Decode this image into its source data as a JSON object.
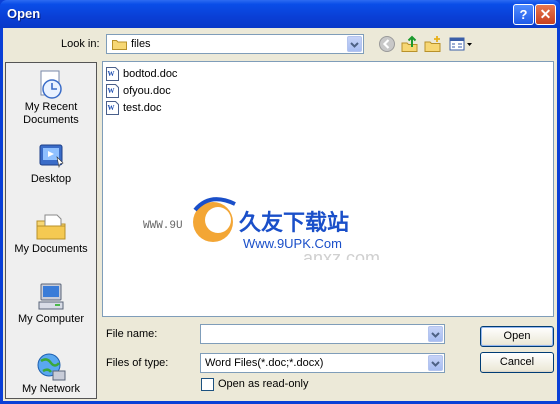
{
  "window": {
    "title": "Open",
    "help_glyph": "?",
    "close_glyph": "✕"
  },
  "lookin": {
    "label": "Look in:",
    "value": "files",
    "icon": "folder-icon"
  },
  "toolbar": {
    "icons": [
      "back-icon",
      "up-folder-icon",
      "new-folder-icon",
      "views-menu-icon"
    ]
  },
  "places": [
    {
      "label": "My Recent\nDocuments",
      "icon": "recent-documents-icon"
    },
    {
      "label": "Desktop",
      "icon": "desktop-icon"
    },
    {
      "label": "My Documents",
      "icon": "my-documents-icon"
    },
    {
      "label": "My Computer",
      "icon": "my-computer-icon"
    },
    {
      "label": "My Network",
      "icon": "my-network-icon"
    }
  ],
  "files": [
    {
      "name": "bodtod.doc",
      "icon": "word-doc-icon"
    },
    {
      "name": "ofyou.doc",
      "icon": "word-doc-icon"
    },
    {
      "name": "test.doc",
      "icon": "word-doc-icon"
    }
  ],
  "filename": {
    "label": "File name:",
    "value": ""
  },
  "filetype": {
    "label": "Files of type:",
    "value": "Word Files(*.doc;*.docx)"
  },
  "readonly": {
    "label": "Open as read-only",
    "checked": false
  },
  "buttons": {
    "open": "Open",
    "cancel": "Cancel"
  },
  "watermark": {
    "site_cn": "久友下载站",
    "url": "Www.9UPK.Com",
    "left_text": "WWW.9U",
    "logo": "anxz.com"
  },
  "colors": {
    "titlebar": "#0a3fd6",
    "client": "#ece9d8",
    "watermark_blue": "#1a4fc9",
    "watermark_orange": "#f29c1f"
  }
}
